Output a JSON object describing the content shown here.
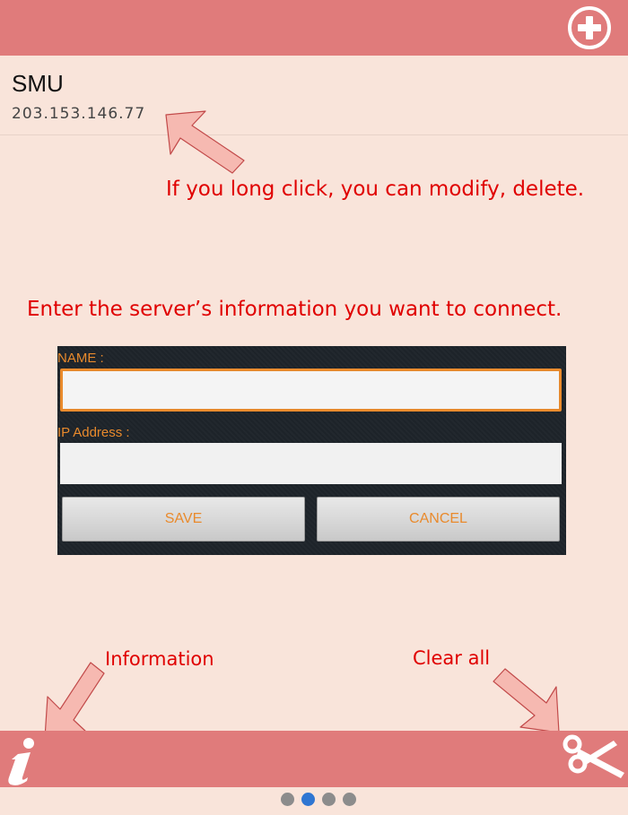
{
  "header": {
    "add_icon": "plus-circle-icon"
  },
  "server": {
    "name": "SMU",
    "ip": "203.153.146.77"
  },
  "notes": {
    "long_click": "If you long click, you can modify, delete.",
    "enter_info": "Enter the server’s information you want to connect.",
    "information": "Information",
    "clear_all": "Clear all"
  },
  "dialog": {
    "name_label": "NAME :",
    "ip_label": "IP Address :",
    "name_value": "",
    "ip_value": "",
    "save_label": "SAVE",
    "cancel_label": "CANCEL"
  },
  "footer": {
    "info_icon": "info-icon",
    "clear_icon": "scissors-icon",
    "page_count": 4,
    "active_page": 2
  },
  "colors": {
    "bar": "#e07b7b",
    "background": "#f9e4da",
    "annotation": "#e00000",
    "dialog_accent": "#e98a2c",
    "active_dot": "#2f76d2"
  }
}
